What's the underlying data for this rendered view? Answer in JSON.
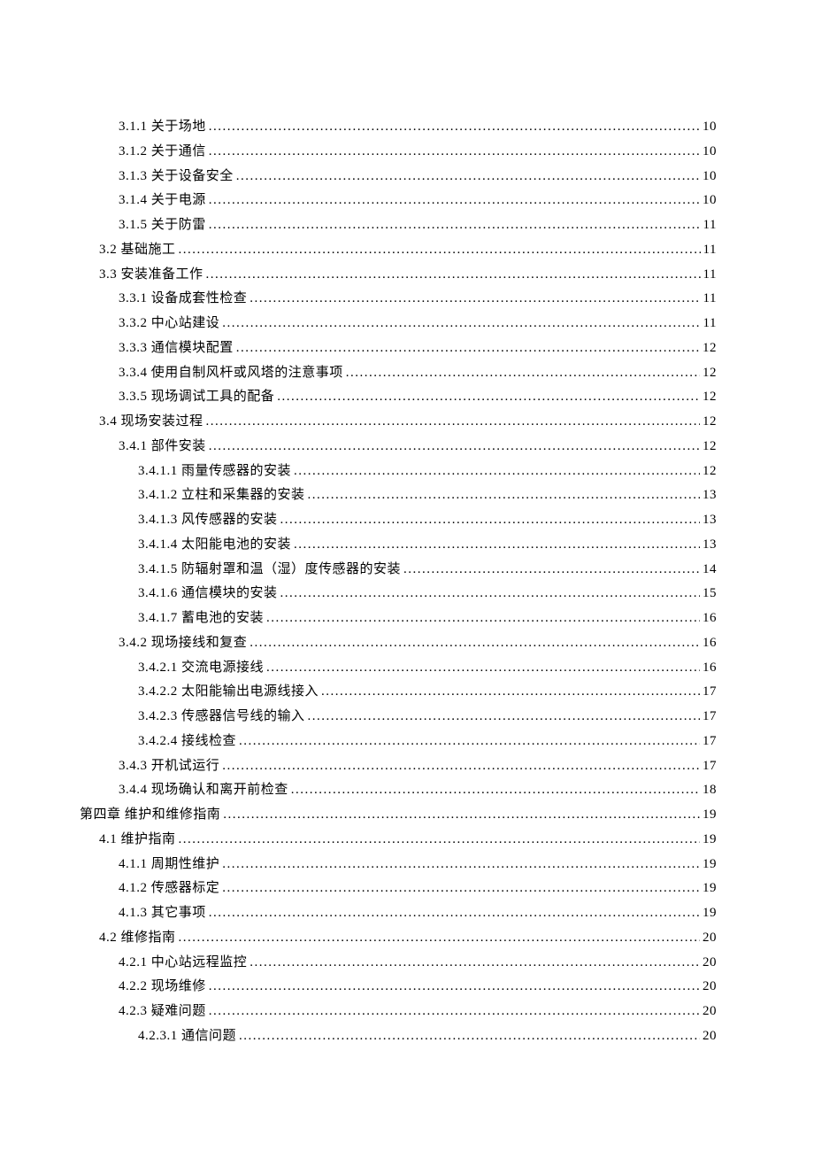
{
  "toc": [
    {
      "level": 2,
      "label": "3.1.1 关于场地",
      "page": "10"
    },
    {
      "level": 2,
      "label": "3.1.2 关于通信",
      "page": "10"
    },
    {
      "level": 2,
      "label": "3.1.3 关于设备安全",
      "page": "10"
    },
    {
      "level": 2,
      "label": "3.1.4 关于电源",
      "page": "10"
    },
    {
      "level": 2,
      "label": "3.1.5 关于防雷",
      "page": "11"
    },
    {
      "level": 1,
      "label": "3.2 基础施工",
      "page": "11"
    },
    {
      "level": 1,
      "label": "3.3 安装准备工作",
      "page": "11"
    },
    {
      "level": 2,
      "label": "3.3.1 设备成套性检查",
      "page": "11"
    },
    {
      "level": 2,
      "label": "3.3.2 中心站建设",
      "page": "11"
    },
    {
      "level": 2,
      "label": "3.3.3 通信模块配置",
      "page": "12"
    },
    {
      "level": 2,
      "label": "3.3.4 使用自制风杆或风塔的注意事项",
      "page": "12"
    },
    {
      "level": 2,
      "label": "3.3.5 现场调试工具的配备",
      "page": "12"
    },
    {
      "level": 1,
      "label": "3.4 现场安装过程",
      "page": "12"
    },
    {
      "level": 2,
      "label": "3.4.1 部件安装",
      "page": "12"
    },
    {
      "level": 3,
      "label": "3.4.1.1 雨量传感器的安装",
      "page": "12"
    },
    {
      "level": 3,
      "label": "3.4.1.2 立柱和采集器的安装",
      "page": "13"
    },
    {
      "level": 3,
      "label": "3.4.1.3 风传感器的安装",
      "page": "13"
    },
    {
      "level": 3,
      "label": "3.4.1.4 太阳能电池的安装",
      "page": "13"
    },
    {
      "level": 3,
      "label": "3.4.1.5 防辐射罩和温（湿）度传感器的安装",
      "page": "14"
    },
    {
      "level": 3,
      "label": "3.4.1.6 通信模块的安装",
      "page": "15"
    },
    {
      "level": 3,
      "label": "3.4.1.7 蓄电池的安装",
      "page": "16"
    },
    {
      "level": 2,
      "label": "3.4.2 现场接线和复查",
      "page": "16"
    },
    {
      "level": 3,
      "label": "3.4.2.1 交流电源接线",
      "page": "16"
    },
    {
      "level": 3,
      "label": "3.4.2.2 太阳能输出电源线接入",
      "page": "17"
    },
    {
      "level": 3,
      "label": "3.4.2.3 传感器信号线的输入",
      "page": "17"
    },
    {
      "level": 3,
      "label": "3.4.2.4 接线检查",
      "page": "17"
    },
    {
      "level": 2,
      "label": "3.4.3 开机试运行",
      "page": "17"
    },
    {
      "level": 2,
      "label": "3.4.4 现场确认和离开前检查",
      "page": "18"
    },
    {
      "level": 0,
      "label": "第四章   维护和维修指南",
      "page": "19"
    },
    {
      "level": 1,
      "label": "4.1 维护指南",
      "page": "19"
    },
    {
      "level": 2,
      "label": "4.1.1 周期性维护",
      "page": "19"
    },
    {
      "level": 2,
      "label": "4.1.2 传感器标定",
      "page": "19"
    },
    {
      "level": 2,
      "label": "4.1.3 其它事项",
      "page": "19"
    },
    {
      "level": 1,
      "label": "4.2 维修指南",
      "page": "20"
    },
    {
      "level": 2,
      "label": "4.2.1 中心站远程监控",
      "page": "20"
    },
    {
      "level": 2,
      "label": "4.2.2 现场维修",
      "page": "20"
    },
    {
      "level": 2,
      "label": "4.2.3 疑难问题",
      "page": "20"
    },
    {
      "level": 3,
      "label": "4.2.3.1 通信问题",
      "page": "20"
    }
  ]
}
